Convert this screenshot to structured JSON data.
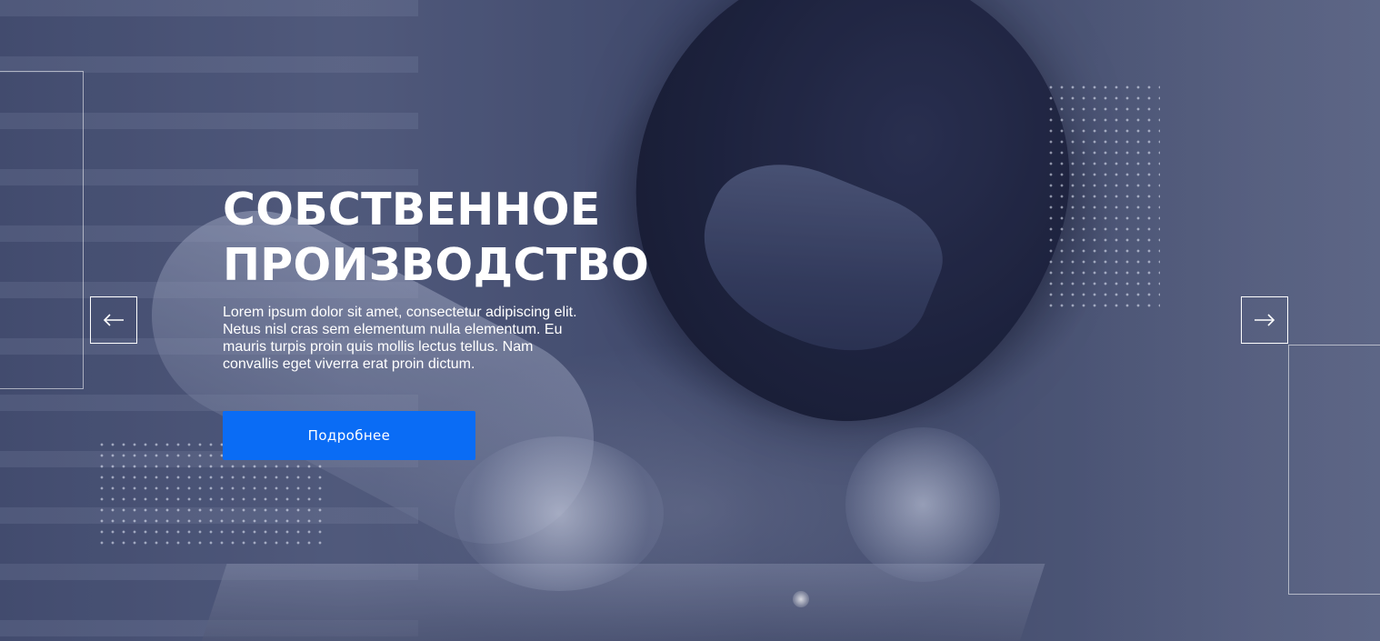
{
  "hero": {
    "title": "СОБСТВЕННОЕ\nПРОИЗВОДСТВО",
    "description": "Lorem ipsum dolor sit amet, consectetur adipiscing elit.\nNetus nisl cras sem elementum nulla elementum. Eu\nmauris turpis proin quis mollis lectus tellus. Nam\nconvallis eget viverra erat proin dictum.",
    "cta_label": "Подробнее",
    "background_image": "welder-in-helmet-photo"
  },
  "navigation": {
    "prev_icon": "arrow-left-icon",
    "next_icon": "arrow-right-icon"
  },
  "colors": {
    "accent": "#0a6cf5",
    "overlay": "#3d4766",
    "text": "#ffffff"
  }
}
